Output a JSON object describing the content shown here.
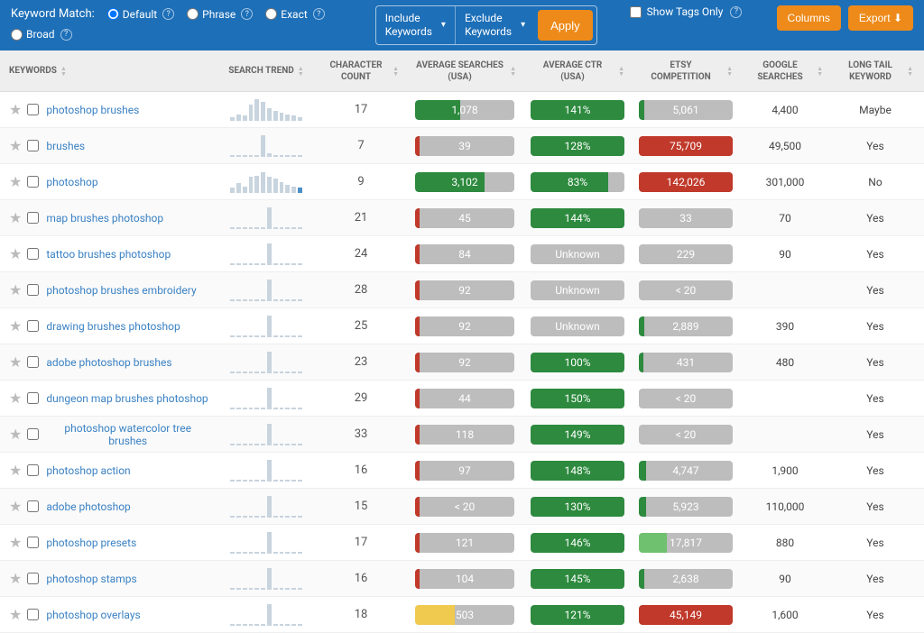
{
  "topbar": {
    "match_label": "Keyword Match:",
    "options": {
      "default": "Default",
      "phrase": "Phrase",
      "exact": "Exact",
      "broad": "Broad"
    },
    "include": "Include\nKeywords",
    "exclude": "Exclude\nKeywords",
    "apply": "Apply",
    "show_tags": "Show Tags Only",
    "columns_btn": "Columns",
    "export_btn": "Export"
  },
  "headers": {
    "keywords": "KEYWORDS",
    "trend": "SEARCH TREND",
    "count": "CHARACTER COUNT",
    "searches": "AVERAGE SEARCHES (USA)",
    "ctr": "AVERAGE CTR (USA)",
    "comp": "ETSY COMPETITION",
    "google": "GOOGLE SEARCHES",
    "longtail": "LONG TAIL KEYWORD"
  },
  "colors": {
    "green": "#2d8a3e",
    "red": "#c0392b",
    "lightgreen": "#6fc06f",
    "yellow": "#f0c94f",
    "gray": "#bdbdbd"
  },
  "rows": [
    {
      "kw": "photoshop brushes",
      "spark": [
        2,
        4,
        3,
        10,
        14,
        12,
        8,
        6,
        5,
        4,
        3,
        2
      ],
      "cc": "17",
      "as": {
        "v": "1,078",
        "fill": 45,
        "color": "green"
      },
      "ctr": {
        "v": "141%",
        "fill": 100,
        "color": "green"
      },
      "comp": {
        "v": "5,061",
        "fill": 6,
        "color": "green",
        "bg": "gray"
      },
      "gs": "4,400",
      "lt": "Maybe"
    },
    {
      "kw": "brushes",
      "spark": [
        1,
        1,
        1,
        1,
        1,
        14,
        2,
        1,
        1,
        1,
        1,
        1
      ],
      "cc": "7",
      "as": {
        "v": "39",
        "fill": 0,
        "notch": "red"
      },
      "ctr": {
        "v": "128%",
        "fill": 100,
        "color": "green"
      },
      "comp": {
        "v": "75,709",
        "fill": 100,
        "color": "red"
      },
      "gs": "49,500",
      "lt": "Yes"
    },
    {
      "kw": "photoshop",
      "spark": [
        3,
        6,
        4,
        10,
        11,
        13,
        10,
        9,
        7,
        5,
        4,
        3
      ],
      "hlIndex": 11,
      "cc": "9",
      "as": {
        "v": "3,102",
        "fill": 70,
        "color": "green"
      },
      "ctr": {
        "v": "83%",
        "fill": 83,
        "color": "green"
      },
      "comp": {
        "v": "142,026",
        "fill": 100,
        "color": "red"
      },
      "gs": "301,000",
      "lt": "No"
    },
    {
      "kw": "map brushes photoshop",
      "spark": [
        1,
        1,
        1,
        1,
        1,
        1,
        14,
        1,
        1,
        1,
        1,
        1
      ],
      "cc": "21",
      "as": {
        "v": "45",
        "fill": 0,
        "notch": "red"
      },
      "ctr": {
        "v": "144%",
        "fill": 100,
        "color": "green"
      },
      "comp": {
        "v": "33",
        "fill": 0,
        "color": "gray"
      },
      "gs": "70",
      "lt": "Yes"
    },
    {
      "kw": "tattoo brushes photoshop",
      "spark": [
        1,
        1,
        1,
        1,
        1,
        1,
        14,
        1,
        1,
        1,
        1,
        1
      ],
      "cc": "24",
      "as": {
        "v": "84",
        "fill": 0,
        "notch": "red"
      },
      "ctr": {
        "v": "Unknown",
        "fill": 0,
        "color": "gray"
      },
      "comp": {
        "v": "229",
        "fill": 0,
        "color": "gray"
      },
      "gs": "90",
      "lt": "Yes"
    },
    {
      "kw": "photoshop brushes embroidery",
      "spark": [
        1,
        1,
        1,
        1,
        1,
        1,
        14,
        1,
        1,
        1,
        1,
        1
      ],
      "cc": "28",
      "as": {
        "v": "92",
        "fill": 0,
        "notch": "red"
      },
      "ctr": {
        "v": "Unknown",
        "fill": 0,
        "color": "gray"
      },
      "comp": {
        "v": "< 20",
        "fill": 0,
        "color": "gray"
      },
      "gs": "",
      "lt": "Yes"
    },
    {
      "kw": "drawing brushes photoshop",
      "spark": [
        1,
        1,
        1,
        1,
        1,
        1,
        14,
        1,
        1,
        1,
        1,
        1
      ],
      "cc": "25",
      "as": {
        "v": "92",
        "fill": 0,
        "notch": "red"
      },
      "ctr": {
        "v": "Unknown",
        "fill": 0,
        "color": "gray"
      },
      "comp": {
        "v": "2,889",
        "fill": 6,
        "color": "green",
        "bg": "gray"
      },
      "gs": "390",
      "lt": "Yes"
    },
    {
      "kw": "adobe photoshop brushes",
      "spark": [
        1,
        1,
        1,
        1,
        1,
        1,
        14,
        1,
        1,
        1,
        1,
        1
      ],
      "cc": "23",
      "as": {
        "v": "92",
        "fill": 0,
        "notch": "red"
      },
      "ctr": {
        "v": "100%",
        "fill": 100,
        "color": "green"
      },
      "comp": {
        "v": "431",
        "fill": 5,
        "color": "green",
        "bg": "gray"
      },
      "gs": "480",
      "lt": "Yes"
    },
    {
      "kw": "dungeon map brushes photoshop",
      "spark": [
        1,
        1,
        1,
        1,
        1,
        1,
        14,
        1,
        1,
        1,
        1,
        1
      ],
      "cc": "29",
      "as": {
        "v": "44",
        "fill": 0,
        "notch": "red"
      },
      "ctr": {
        "v": "150%",
        "fill": 100,
        "color": "green"
      },
      "comp": {
        "v": "< 20",
        "fill": 0,
        "color": "gray"
      },
      "gs": "",
      "lt": "Yes"
    },
    {
      "kw": "photoshop watercolor tree brushes",
      "spark": [
        1,
        1,
        1,
        1,
        1,
        1,
        14,
        1,
        1,
        1,
        1,
        1
      ],
      "cc": "33",
      "as": {
        "v": "118",
        "fill": 0,
        "notch": "red"
      },
      "ctr": {
        "v": "149%",
        "fill": 100,
        "color": "green"
      },
      "comp": {
        "v": "< 20",
        "fill": 0,
        "color": "gray"
      },
      "gs": "",
      "lt": "Yes"
    },
    {
      "kw": "photoshop action",
      "spark": [
        1,
        1,
        1,
        1,
        1,
        1,
        14,
        1,
        1,
        1,
        1,
        1
      ],
      "cc": "16",
      "as": {
        "v": "97",
        "fill": 0,
        "notch": "red"
      },
      "ctr": {
        "v": "148%",
        "fill": 100,
        "color": "green"
      },
      "comp": {
        "v": "4,747",
        "fill": 8,
        "color": "green",
        "bg": "gray"
      },
      "gs": "1,900",
      "lt": "Yes"
    },
    {
      "kw": "adobe photoshop",
      "spark": [
        1,
        1,
        1,
        1,
        1,
        1,
        14,
        1,
        1,
        1,
        1,
        1
      ],
      "cc": "15",
      "as": {
        "v": "< 20",
        "fill": 0,
        "notch": "red"
      },
      "ctr": {
        "v": "130%",
        "fill": 100,
        "color": "green"
      },
      "comp": {
        "v": "5,923",
        "fill": 8,
        "color": "green",
        "bg": "gray"
      },
      "gs": "110,000",
      "lt": "Yes"
    },
    {
      "kw": "photoshop presets",
      "spark": [
        1,
        1,
        1,
        1,
        1,
        1,
        14,
        1,
        1,
        1,
        1,
        1
      ],
      "cc": "17",
      "as": {
        "v": "121",
        "fill": 0,
        "notch": "red"
      },
      "ctr": {
        "v": "146%",
        "fill": 100,
        "color": "green"
      },
      "comp": {
        "v": "17,817",
        "fill": 30,
        "color": "lightgreen",
        "bg": "gray"
      },
      "gs": "880",
      "lt": "Yes"
    },
    {
      "kw": "photoshop stamps",
      "spark": [
        1,
        1,
        1,
        1,
        1,
        1,
        14,
        1,
        1,
        1,
        1,
        1
      ],
      "cc": "16",
      "as": {
        "v": "104",
        "fill": 0,
        "notch": "red"
      },
      "ctr": {
        "v": "145%",
        "fill": 100,
        "color": "green"
      },
      "comp": {
        "v": "2,638",
        "fill": 6,
        "color": "green",
        "bg": "gray"
      },
      "gs": "90",
      "lt": "Yes"
    },
    {
      "kw": "photoshop overlays",
      "spark": [
        1,
        1,
        1,
        1,
        1,
        1,
        14,
        1,
        1,
        1,
        1,
        1
      ],
      "cc": "18",
      "as": {
        "v": "503",
        "fill": 40,
        "color": "yellow"
      },
      "ctr": {
        "v": "121%",
        "fill": 100,
        "color": "green"
      },
      "comp": {
        "v": "45,149",
        "fill": 100,
        "color": "red"
      },
      "gs": "1,600",
      "lt": "Yes"
    }
  ]
}
